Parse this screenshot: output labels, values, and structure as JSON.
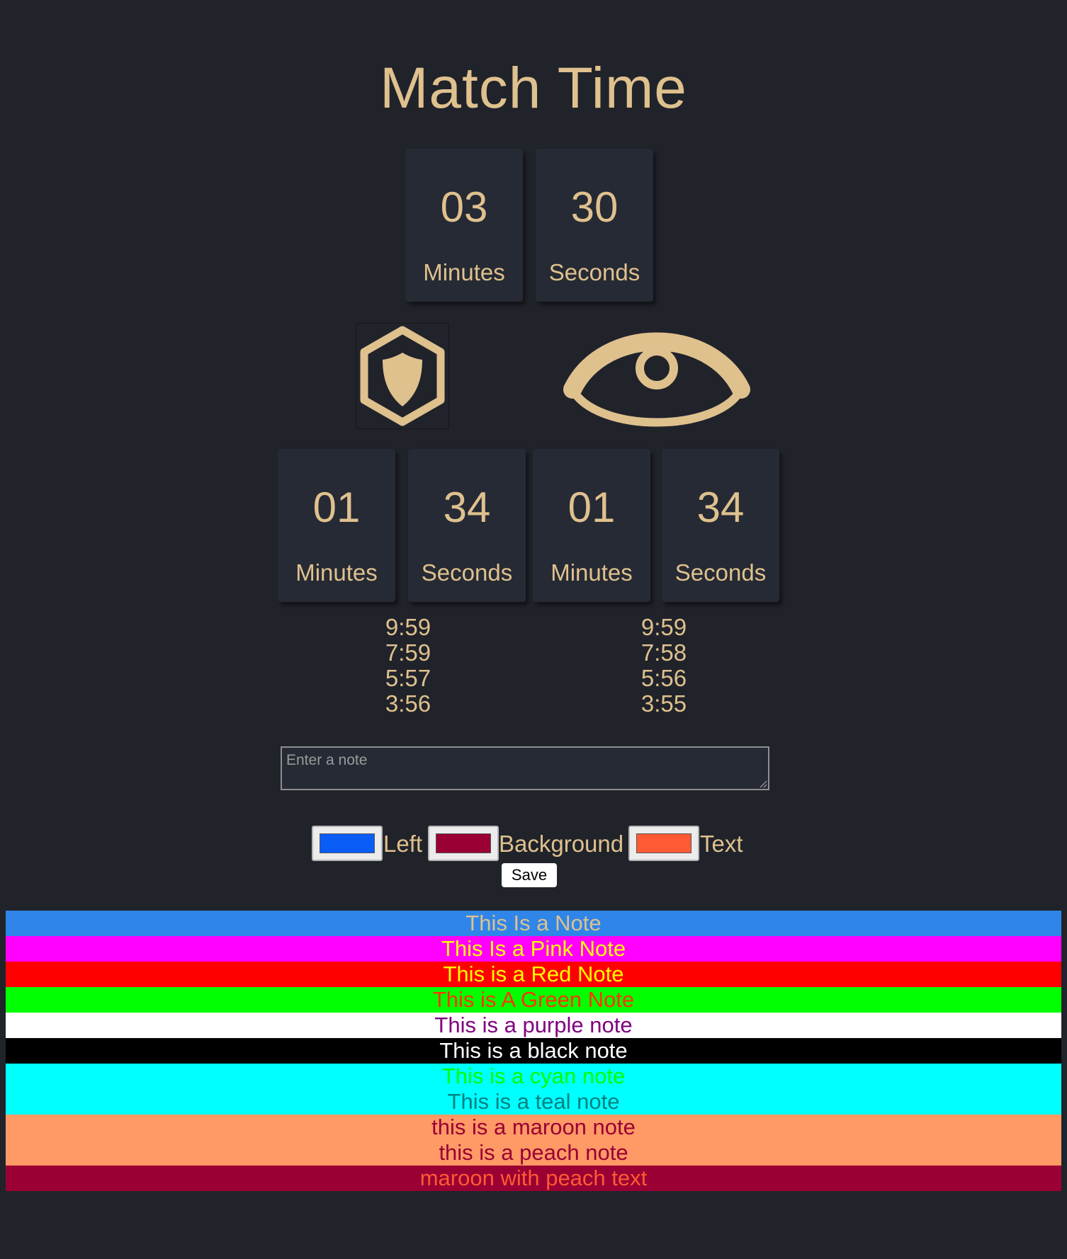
{
  "title": "Match Time",
  "match_timer": {
    "minutes": "03",
    "minutes_label": "Minutes",
    "seconds": "30",
    "seconds_label": "Seconds"
  },
  "icons": {
    "left": "shield-hexagon-icon",
    "right": "eye-icon"
  },
  "left_timer": {
    "minutes": "01",
    "minutes_label": "Minutes",
    "seconds": "34",
    "seconds_label": "Seconds",
    "times": [
      "9:59",
      "7:59",
      "5:57",
      "3:56"
    ]
  },
  "right_timer": {
    "minutes": "01",
    "minutes_label": "Minutes",
    "seconds": "34",
    "seconds_label": "Seconds",
    "times": [
      "9:59",
      "7:58",
      "5:56",
      "3:55"
    ]
  },
  "note_form": {
    "placeholder": "Enter a note",
    "left_label": "Left",
    "left_color": "#0a5cf7",
    "background_label": "Background",
    "background_color": "#9a0033",
    "text_label": "Text",
    "text_color": "#ff5a33",
    "save_label": "Save"
  },
  "notes": [
    {
      "text": "This Is a Note",
      "bg": "#2f86e8",
      "color": "#dfc18e"
    },
    {
      "text": "This Is a Pink Note",
      "bg": "#ff00ff",
      "color": "#ffff00"
    },
    {
      "text": "This is a Red Note",
      "bg": "#ff0000",
      "color": "#ffff00"
    },
    {
      "text": "This is A Green Note",
      "bg": "#00ff00",
      "color": "#ff3300"
    },
    {
      "text": "This is a purple note",
      "bg": "#ffffff",
      "color": "#800080"
    },
    {
      "text": "This is a black note",
      "bg": "#000000",
      "color": "#ffffff"
    },
    {
      "text": "This is a cyan note",
      "bg": "#00ffff",
      "color": "#00ff00"
    },
    {
      "text": "This is a teal note",
      "bg": "#00ffff",
      "color": "#008080"
    },
    {
      "text": "this is a maroon note",
      "bg": "#ff9966",
      "color": "#9a0033"
    },
    {
      "text": "this is a peach note",
      "bg": "#ff9966",
      "color": "#9a0033"
    },
    {
      "text": "maroon with peach text",
      "bg": "#9a0033",
      "color": "#ff5a33"
    }
  ]
}
